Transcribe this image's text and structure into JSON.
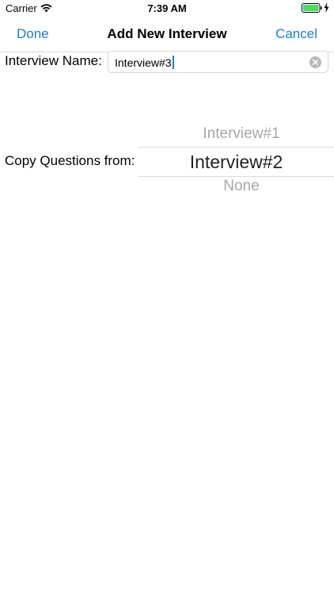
{
  "status_bar": {
    "carrier": "Carrier",
    "time": "7:39 AM",
    "wifi_icon": "wifi-icon",
    "battery_icon": "battery-icon",
    "charging_icon": "bolt-icon",
    "battery_color": "#4cd964"
  },
  "nav": {
    "done_label": "Done",
    "title": "Add New Interview",
    "cancel_label": "Cancel",
    "accent_color": "#1a7dd1"
  },
  "form": {
    "name_label": "Interview Name:",
    "name_value": "Interview#3",
    "clear_icon": "clear-circle-icon",
    "copy_label": "Copy Questions from:",
    "picker": {
      "options": [
        "Interview#1",
        "Interview#2",
        "None"
      ],
      "selected": "Interview#2"
    }
  }
}
